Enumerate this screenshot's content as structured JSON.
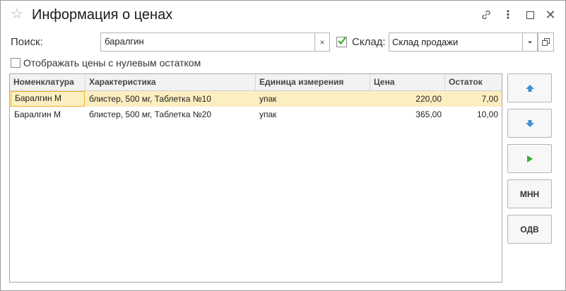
{
  "window": {
    "title": "Информация о ценах"
  },
  "search": {
    "label": "Поиск:",
    "value": "баралгин",
    "clear_symbol": "×"
  },
  "sklad": {
    "label": "Склад:",
    "checked": true,
    "value": "Склад продажи"
  },
  "zero_stock": {
    "label": "Отображать цены с нулевым остатком",
    "checked": false
  },
  "table": {
    "columns": [
      "Номенклатура",
      "Характеристика",
      "Единица измерения",
      "Цена",
      "Остаток"
    ],
    "rows": [
      [
        "Баралгин М",
        "блистер, 500 мг, Таблетка №10",
        "упак",
        "220,00",
        "7,00"
      ],
      [
        "Баралгин М",
        "блистер, 500 мг, Таблетка №20",
        "упак",
        "365,00",
        "10,00"
      ]
    ],
    "selected_row": 0
  },
  "side_buttons": {
    "up_icon": "arrow-up-icon",
    "down_icon": "arrow-down-icon",
    "play_icon": "play-icon",
    "mnn_label": "МНН",
    "odv_label": "ОДВ"
  },
  "colors": {
    "selection": "#fbeec0",
    "focus_border": "#f0b429",
    "arrow_blue": "#3d8fd6",
    "play_green": "#3aaa35",
    "checkbox_green": "#3aaa35"
  }
}
